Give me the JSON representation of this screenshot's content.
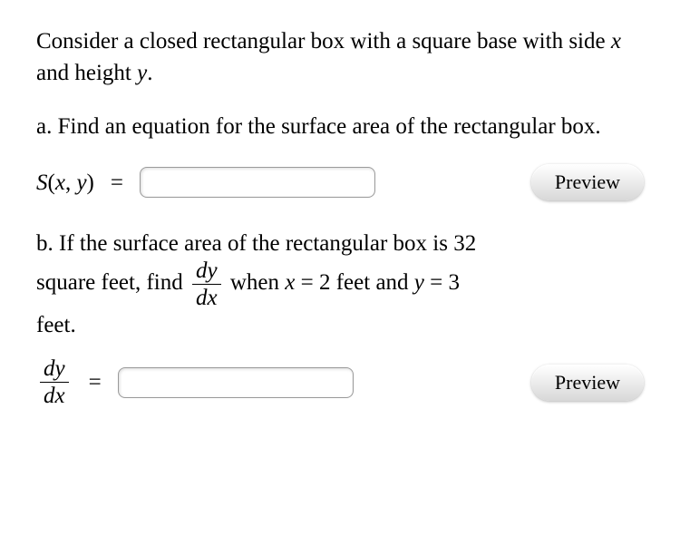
{
  "problem": {
    "intro": "Consider a closed rectangular box with a square base with side ",
    "intro_var1": "x",
    "intro_mid": " and height ",
    "intro_var2": "y",
    "intro_end": ".",
    "partA": {
      "label": "a. Find an equation for the surface area of the rectangular box.",
      "lhs_func": "S",
      "lhs_open": "(",
      "lhs_arg1": "x",
      "lhs_comma": ", ",
      "lhs_arg2": "y",
      "lhs_close": ")",
      "equals": "="
    },
    "partB": {
      "line1_pre": "b. If the surface area of the rectangular box is ",
      "line1_val": "32",
      "line2_pre": "square feet, find ",
      "frac_num": "dy",
      "frac_den": "dx",
      "when_text": " when ",
      "x_var": "x",
      "eq1": " = ",
      "x_val": "2 feet",
      "and_text": " and ",
      "y_var": "y",
      "eq2": " = ",
      "y_val": "3",
      "line3": "feet.",
      "answer_frac_num": "dy",
      "answer_frac_den": "dx",
      "answer_equals": "="
    }
  },
  "buttons": {
    "preview": "Preview"
  }
}
